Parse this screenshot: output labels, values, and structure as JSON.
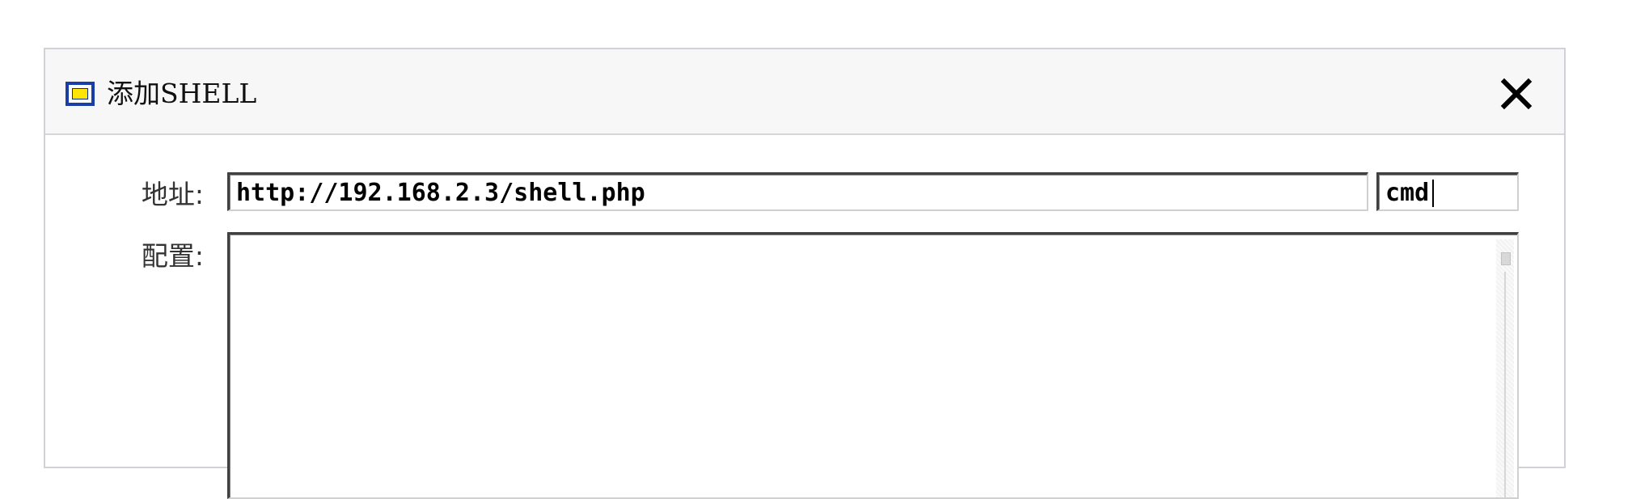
{
  "dialog": {
    "title": "添加SHELL",
    "app_icon": "window-icon",
    "close_icon": "close-icon"
  },
  "form": {
    "address_label": "地址:",
    "address_value": "http://192.168.2.3/shell.php",
    "password_value": "cmd",
    "config_label": "配置:",
    "config_value": ""
  },
  "colors": {
    "icon_border": "#1b3ea6",
    "icon_fill": "#ffe500",
    "titlebar_bg": "#f7f7f7"
  }
}
